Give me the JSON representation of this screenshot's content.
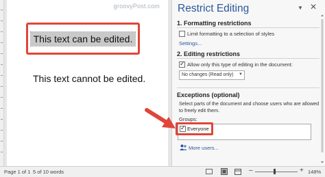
{
  "document": {
    "watermark": "groovyPost.com",
    "editable_text": "This text can be edited.",
    "locked_text": "This text cannot be edited."
  },
  "pane": {
    "title": "Restrict Editing",
    "formatting": {
      "heading": "1. Formatting restrictions",
      "checkbox_label": "Limit formatting to a selection of styles",
      "checkbox_checked": false,
      "settings_link": "Settings..."
    },
    "editing": {
      "heading": "2. Editing restrictions",
      "checkbox_label": "Allow only this type of editing in the document:",
      "checkbox_checked": true,
      "select_value": "No changes (Read only)"
    },
    "exceptions": {
      "heading": "Exceptions (optional)",
      "description": "Select parts of the document and choose users who are allowed to freely edit them.",
      "groups_label": "Groups:",
      "groups": [
        {
          "label": "Everyone",
          "checked": true
        }
      ],
      "more_users_link": "More users..."
    }
  },
  "status_bar": {
    "page": "Page 1 of 1",
    "words": "5 of 10 words",
    "zoom": "148%"
  },
  "colors": {
    "accent": "#2b579a",
    "highlight_red": "#e0453a"
  },
  "icons": {
    "pane_dropdown": "chevron-down-icon",
    "pane_close": "close-icon",
    "more_users": "users-icon",
    "callout": "arrow-icon"
  }
}
